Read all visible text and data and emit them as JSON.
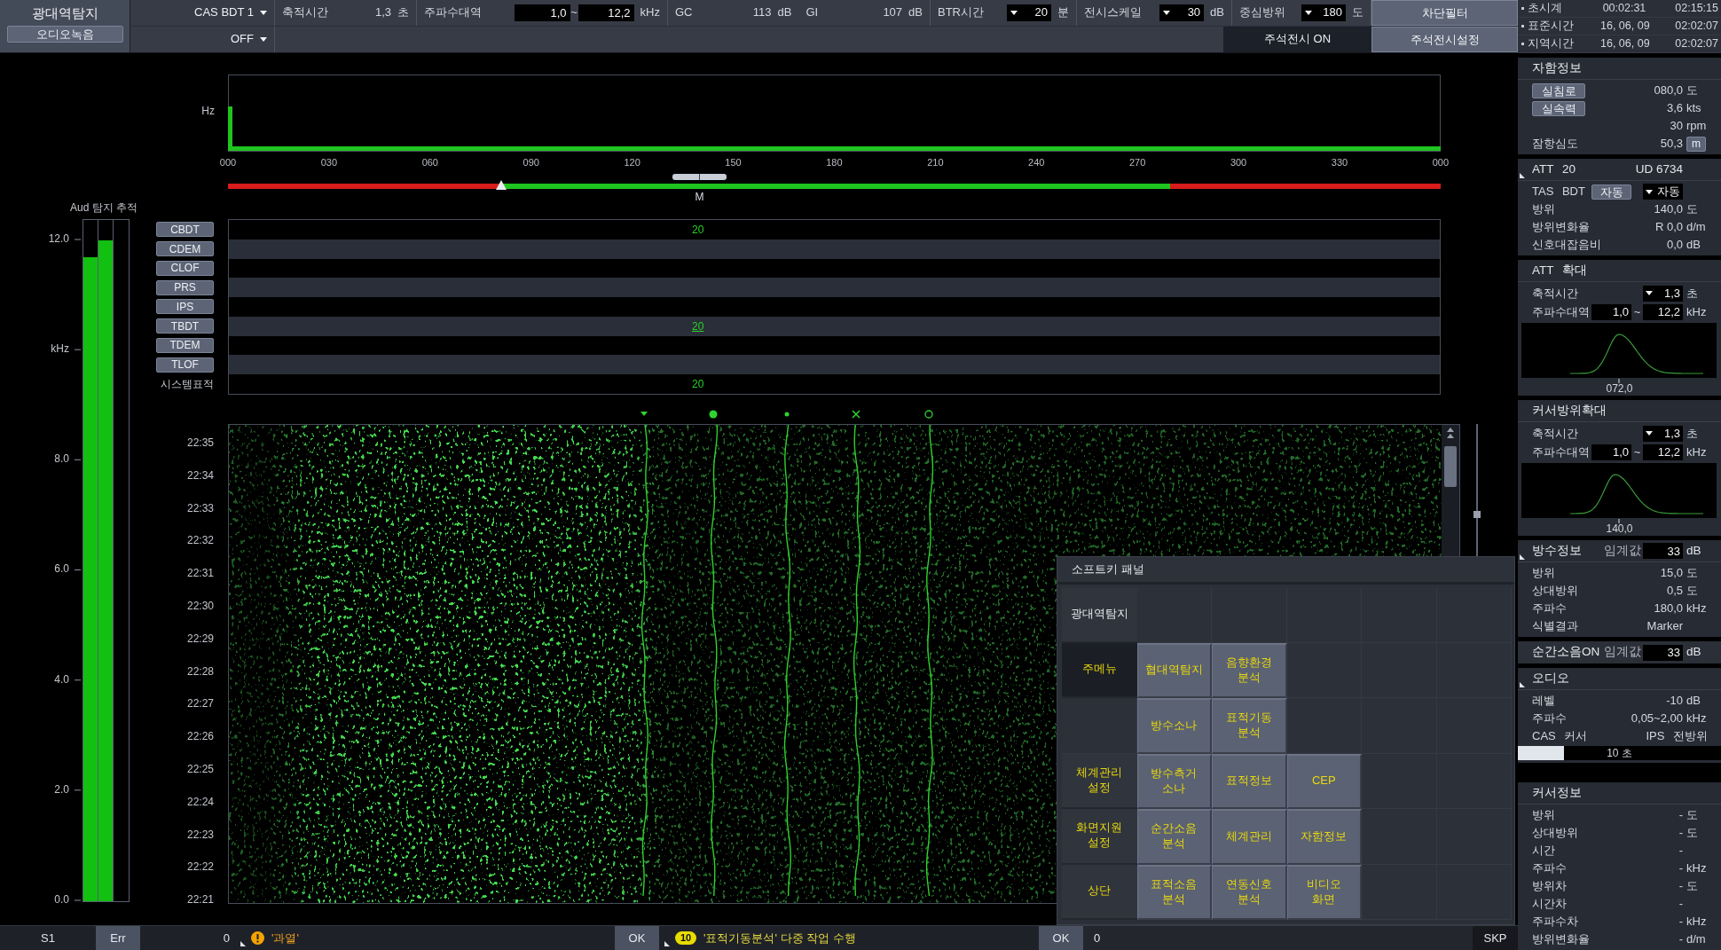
{
  "top_bar": {
    "mode_title": "광대역탐지",
    "record_button": "오디오녹음",
    "source_select": "CAS BDT 1",
    "output_select": "OFF",
    "field_groups": [
      [
        {
          "kind": "readout",
          "label": "축적시간",
          "value": "1,3",
          "unit": "초"
        }
      ],
      [
        {
          "kind": "range",
          "label": "주파수대역",
          "from": "1,0",
          "joiner": "~",
          "to": "12,2",
          "unit": "kHz"
        }
      ],
      [
        {
          "kind": "readout",
          "label": "GC",
          "value": "113",
          "unit": "dB"
        },
        {
          "kind": "readout",
          "label": "GI",
          "value": "107",
          "unit": "dB"
        }
      ],
      [
        {
          "kind": "select",
          "label": "BTR시간",
          "value": "20",
          "unit": "분"
        }
      ],
      [
        {
          "kind": "select",
          "label": "전시스케일",
          "value": "30",
          "unit": "dB"
        }
      ],
      [
        {
          "kind": "select",
          "label": "중심방위",
          "value": "180",
          "unit": "도"
        }
      ]
    ],
    "filter_button": "차단필터",
    "annotation_toggle": "주석전시 ON",
    "annotation_settings_button": "주석전시설정"
  },
  "audio_meter": {
    "title": "Aud 탐지 추적",
    "scale": [
      "12.0",
      "kHz",
      "8.0",
      "6.0",
      "4.0",
      "2.0",
      "0.0"
    ],
    "bars": [
      {
        "level": 0.945
      },
      {
        "level": 0.97
      }
    ]
  },
  "bearing_spectrum": {
    "unit": "Hz",
    "ticks": [
      "000",
      "030",
      "060",
      "090",
      "120",
      "150",
      "180",
      "210",
      "240",
      "270",
      "300",
      "330",
      "000"
    ]
  },
  "sector_bar": {
    "blocked": [
      {
        "level": 0.225
      },
      {
        "level": 0.223
      }
    ],
    "label": "M"
  },
  "tracks": [
    {
      "kind": "button",
      "label": "CBDT",
      "value": "20",
      "selected": false
    },
    {
      "kind": "button",
      "label": "CDEM"
    },
    {
      "kind": "button",
      "label": "CLOF"
    },
    {
      "kind": "button",
      "label": "PRS"
    },
    {
      "kind": "button",
      "label": "IPS"
    },
    {
      "kind": "button",
      "label": "TBDT",
      "value": "20",
      "selected": true
    },
    {
      "kind": "button",
      "label": "TDEM"
    },
    {
      "kind": "button",
      "label": "TLOF"
    },
    {
      "kind": "text",
      "label": "시스템표적",
      "value": "20",
      "selected": false
    }
  ],
  "waterfall": {
    "times": [
      "22:35",
      "22:34",
      "22:33",
      "22:32",
      "22:31",
      "22:30",
      "22:29",
      "22:28",
      "22:27",
      "22:26",
      "22:25",
      "22:24",
      "22:23",
      "22:22",
      "22:21"
    ]
  },
  "softkey_panel": {
    "title": "소프트키 패널",
    "rows": [
      [
        {
          "kind": "title",
          "label": "광대역탐지"
        },
        {
          "kind": "blank"
        },
        {
          "kind": "blank"
        },
        {
          "kind": "blank"
        },
        {
          "kind": "blank"
        },
        {
          "kind": "blank"
        }
      ],
      [
        {
          "kind": "menu",
          "label": "주메뉴",
          "selected": true
        },
        {
          "kind": "key",
          "label": "협대역탐지",
          "selected": false
        },
        {
          "kind": "key",
          "label": "음향환경\n분석",
          "selected": false
        },
        {
          "kind": "blank"
        },
        {
          "kind": "blank"
        },
        {
          "kind": "blank"
        }
      ],
      [
        {
          "kind": "blank"
        },
        {
          "kind": "key",
          "label": "방수소나",
          "selected": false
        },
        {
          "kind": "key",
          "label": "표적기동\n분석",
          "selected": false
        },
        {
          "kind": "blank"
        },
        {
          "kind": "blank"
        },
        {
          "kind": "blank"
        }
      ],
      [
        {
          "kind": "menu",
          "label": "체계관리\n설정",
          "selected": false
        },
        {
          "kind": "key",
          "label": "방수측거\n소나",
          "selected": false
        },
        {
          "kind": "key",
          "label": "표적정보",
          "selected": false
        },
        {
          "kind": "key",
          "label": "CEP",
          "selected": false
        },
        {
          "kind": "blank"
        },
        {
          "kind": "blank"
        }
      ],
      [
        {
          "kind": "menu",
          "label": "화면지원\n설정",
          "selected": false
        },
        {
          "kind": "key",
          "label": "순간소음\n분석",
          "selected": false
        },
        {
          "kind": "key",
          "label": "체계관리",
          "selected": false
        },
        {
          "kind": "key",
          "label": "자함정보",
          "selected": false
        },
        {
          "kind": "blank"
        },
        {
          "kind": "blank"
        }
      ],
      [
        {
          "kind": "menu",
          "label": "상단",
          "selected": false
        },
        {
          "kind": "key",
          "label": "표적소음\n분석",
          "selected": false
        },
        {
          "kind": "key",
          "label": "연동신호\n분석",
          "selected": false
        },
        {
          "kind": "key",
          "label": "비디오\n화면",
          "selected": false
        },
        {
          "kind": "blank"
        },
        {
          "kind": "blank"
        }
      ]
    ]
  },
  "status_bar": {
    "items": [
      {
        "kind": "code",
        "text": "S1"
      },
      {
        "kind": "button",
        "text": "Err"
      },
      {
        "kind": "counter",
        "text": "0"
      },
      {
        "kind": "warning",
        "text": "'과열'"
      },
      {
        "kind": "button",
        "text": "OK"
      },
      {
        "kind": "badge",
        "badge": "10",
        "text": "'표적기동분석' 다중 작업 수행"
      },
      {
        "kind": "button",
        "text": "OK"
      },
      {
        "kind": "input",
        "text": "0"
      },
      {
        "kind": "code",
        "text": "SKP"
      }
    ]
  },
  "side_panel": {
    "clocks": [
      {
        "label": "초시계",
        "values": [
          "00:02:31",
          "02:15:15"
        ]
      },
      {
        "label": "표준시간",
        "values": [
          "16, 06, 09",
          "02:02:07"
        ]
      },
      {
        "label": "지역시간",
        "values": [
          "16, 06, 09",
          "02:02:07"
        ]
      }
    ],
    "sections": [
      {
        "kind": "info",
        "title": "자함정보",
        "rows": [
          {
            "kind": "keyed",
            "label": "실침로",
            "value": "080,0",
            "unit": "도"
          },
          {
            "kind": "keyed",
            "label": "실속력",
            "value": "3,6",
            "unit": "kts"
          },
          {
            "kind": "plain",
            "value": "30",
            "unit": "rpm"
          },
          {
            "kind": "plain",
            "label": "잠항심도",
            "value": "50,3",
            "unit": "m",
            "unit_button": true
          }
        ]
      },
      {
        "kind": "info",
        "title": "ATT 20",
        "title_right": "UD 6734",
        "corner_mark": true,
        "rows": [
          {
            "kind": "mode",
            "label": "TAS BDT",
            "button": "자동",
            "select": "자동"
          },
          {
            "kind": "plain",
            "label": "방위",
            "value": "140,0",
            "unit": "도"
          },
          {
            "kind": "plain",
            "label": "방위변화율",
            "value": "R 0,0",
            "unit": "d/m"
          },
          {
            "kind": "plain",
            "label": "신호대잡음비",
            "value": "0,0",
            "unit": "dB"
          }
        ]
      },
      {
        "kind": "zoom",
        "title": "ATT 확대",
        "rows": [
          {
            "kind": "select",
            "label": "축적시간",
            "value": "1,3",
            "unit": "초"
          },
          {
            "kind": "range",
            "label": "주파수대역",
            "from": "1,0",
            "joiner": "~",
            "to": "12,2",
            "unit": "kHz"
          }
        ],
        "peak_label": "072,0"
      },
      {
        "kind": "zoom",
        "title": "커서방위확대",
        "rows": [
          {
            "kind": "select",
            "label": "축적시간",
            "value": "1,3",
            "unit": "초"
          },
          {
            "kind": "range",
            "label": "주파수대역",
            "from": "1,0",
            "joiner": "~",
            "to": "12,2",
            "unit": "kHz"
          }
        ],
        "peak_label": "140,0"
      },
      {
        "kind": "info",
        "title": "방수정보",
        "corner_mark": true,
        "threshold": {
          "label": "임계값",
          "value": "33",
          "unit": "dB"
        },
        "rows": [
          {
            "kind": "plain",
            "label": "방위",
            "value": "15,0",
            "unit": "도"
          },
          {
            "kind": "plain",
            "label": "상대방위",
            "value": "0,5",
            "unit": "도"
          },
          {
            "kind": "plain",
            "label": "주파수",
            "value": "180,0",
            "unit": "kHz"
          },
          {
            "kind": "plain",
            "label": "식별결과",
            "value": "Marker"
          }
        ]
      },
      {
        "kind": "bar",
        "title": "순간소음ON",
        "threshold": {
          "label": "임계값",
          "value": "33",
          "unit": "dB"
        }
      },
      {
        "kind": "info",
        "title": "오디오",
        "corner_mark": true,
        "rows": [
          {
            "kind": "plain",
            "label": "레벨",
            "value": "-10",
            "unit": "dB"
          },
          {
            "kind": "plain",
            "label": "주파수",
            "value": "0,05~2,00",
            "unit": "kHz"
          },
          {
            "kind": "pair",
            "label": "CAS 커서",
            "value": "IPS 전방위"
          },
          {
            "kind": "progress",
            "level": 0.226,
            "text": "10 초"
          }
        ]
      },
      {
        "kind": "info",
        "title": "커서정보",
        "rows": [
          {
            "kind": "plain",
            "label": "방위",
            "value": "-",
            "unit": "도"
          },
          {
            "kind": "plain",
            "label": "상대방위",
            "value": "-",
            "unit": "도"
          },
          {
            "kind": "plain",
            "label": "시간",
            "value": "-"
          },
          {
            "kind": "plain",
            "label": "주파수",
            "value": "-",
            "unit": "kHz"
          },
          {
            "kind": "plain",
            "label": "방위차",
            "value": "-",
            "unit": "도"
          },
          {
            "kind": "plain",
            "label": "시간차",
            "value": "-"
          },
          {
            "kind": "plain",
            "label": "주파수차",
            "value": "-",
            "unit": "kHz"
          },
          {
            "kind": "plain",
            "label": "방위변화율",
            "value": "-",
            "unit": "d/m"
          }
        ]
      }
    ]
  }
}
